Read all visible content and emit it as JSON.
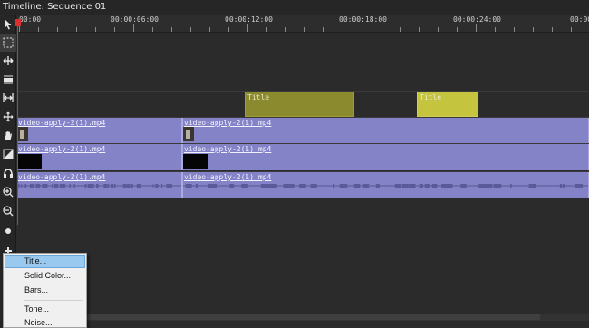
{
  "window": {
    "title": "Timeline: Sequence 01"
  },
  "ruler": {
    "labels": [
      "00:00",
      "00:00:06:00",
      "00:00:12:00",
      "00:00:18:00",
      "00:00:24:00",
      "00:00"
    ]
  },
  "tracks": {
    "title_clips": [
      {
        "label": "Title",
        "color": "#8b8a2f"
      },
      {
        "label": "Title",
        "color": "#c5c43e"
      }
    ],
    "video_track_1": [
      {
        "label": "video-apply-2(1).mp4"
      },
      {
        "label": "video-apply-2(1).mp4"
      }
    ],
    "video_track_2": [
      {
        "label": "video-apply-2(1).mp4"
      },
      {
        "label": "video-apply-2(1).mp4"
      }
    ],
    "audio_track": [
      {
        "label": "video-apply-2(1).mp4"
      },
      {
        "label": "video-apply-2(1).mp4"
      }
    ]
  },
  "tools": [
    "select-arrow-icon",
    "marquee-select-icon",
    "ripple-edit-icon",
    "slip-icon",
    "stretch-icon",
    "move-icon",
    "hand-icon",
    "crop-icon",
    "audio-icon",
    "zoom-in-icon",
    "zoom-out-icon",
    "record-icon",
    "add-icon"
  ],
  "context_menu": {
    "items": [
      "Title...",
      "Solid Color...",
      "Bars...",
      "Tone...",
      "Noise..."
    ],
    "highlighted": "Title..."
  },
  "colors": {
    "playhead": "#d83030",
    "clip_video": "#8583c7",
    "clip_title_dark": "#8b8a2f",
    "clip_title_light": "#c5c43e",
    "menu_highlight": "#99c9ef"
  }
}
